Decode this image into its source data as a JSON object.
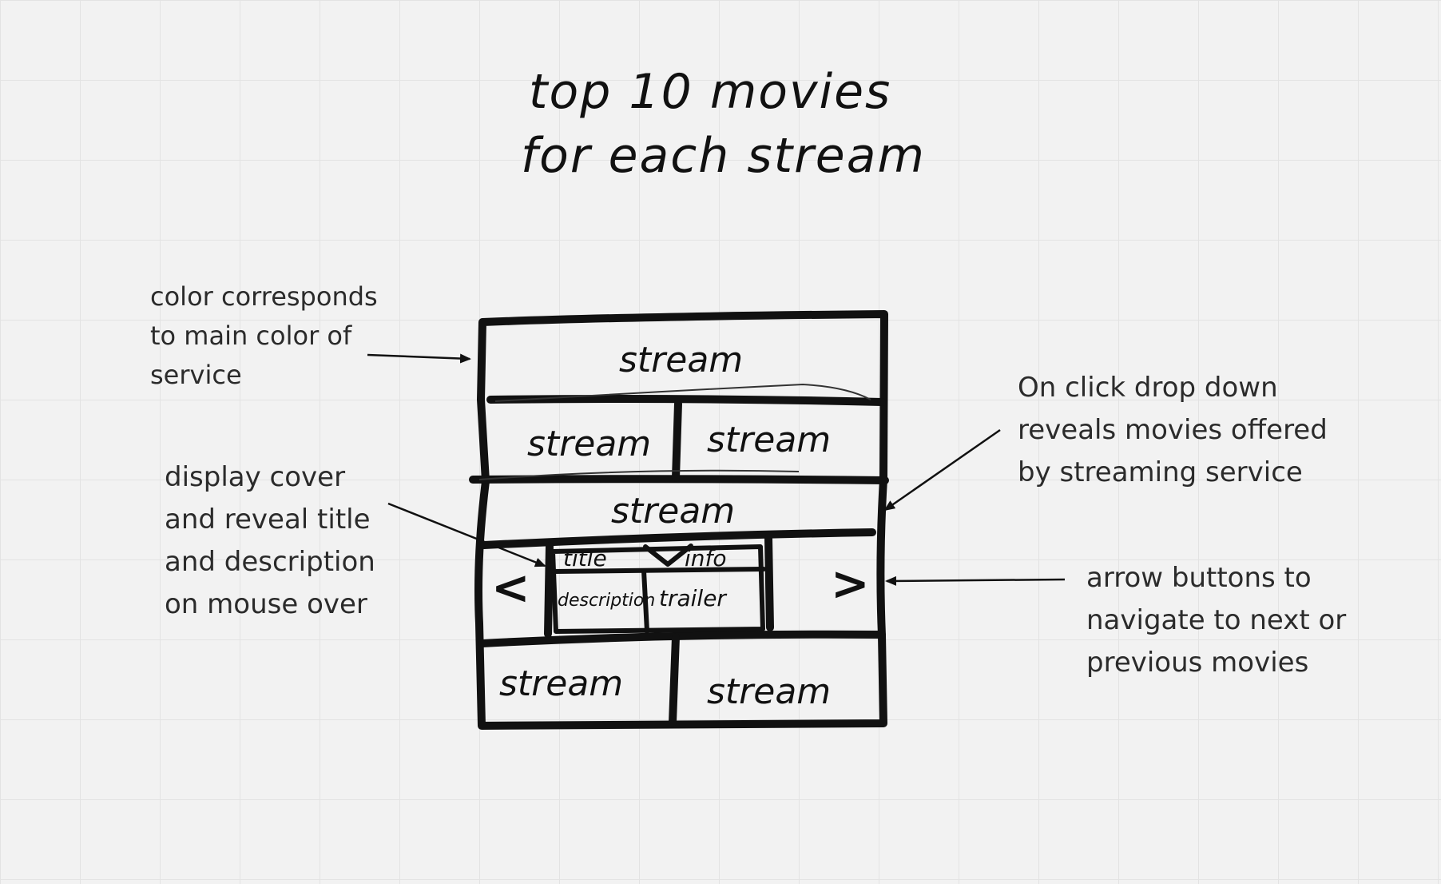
{
  "title": {
    "line1": "top 10 movies",
    "line2": "for each stream"
  },
  "wireframe": {
    "row1": {
      "label": "stream"
    },
    "row2": {
      "left": "stream",
      "right": "stream"
    },
    "row3": {
      "label": "stream",
      "prev_arrow": "<",
      "next_arrow": ">",
      "card": {
        "title": "title",
        "info": "info",
        "description": "description",
        "trailer": "trailer"
      }
    },
    "row4": {
      "left": "stream",
      "right": "stream"
    }
  },
  "annotations": {
    "color": [
      "color corresponds",
      "to main color of",
      "service"
    ],
    "dropdown": [
      "On click drop down",
      "reveals movies offered",
      "by streaming service"
    ],
    "cover": [
      "display cover",
      "and reveal title",
      "and description",
      "on mouse over"
    ],
    "arrows": [
      "arrow buttons to",
      "navigate to next or",
      "previous movies"
    ]
  }
}
